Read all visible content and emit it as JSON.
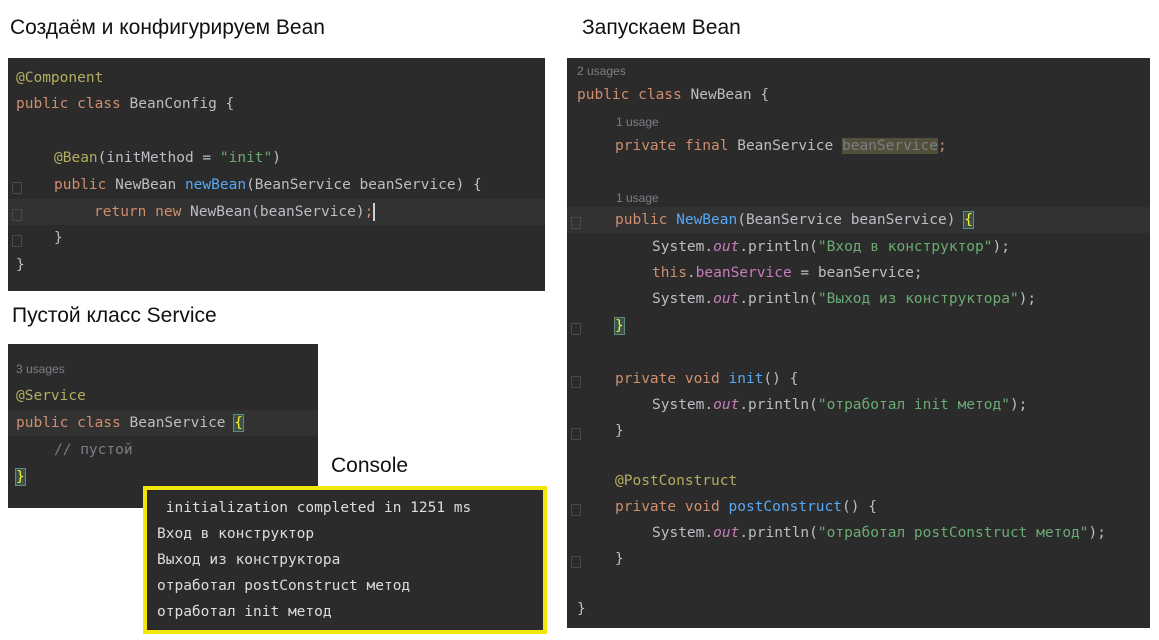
{
  "captions": {
    "config": "Создаём и конфигурируем Bean",
    "run": "Запускаем Bean",
    "service": "Пустой класс Service",
    "console": "Console"
  },
  "config_code": {
    "l1_ann": "@Component",
    "l2_kw": "public class ",
    "l2_name": "BeanConfig {",
    "l4_ann": "@Bean",
    "l4_rest": "(initMethod = ",
    "l4_str": "\"init\"",
    "l4_end": ")",
    "l5_kw": "public ",
    "l5_type": "NewBean ",
    "l5_fn": "newBean",
    "l5_rest": "(BeanService beanService) {",
    "l6_kw": "return new ",
    "l6_rest": "NewBean(beanService)",
    "l6_semi": ";",
    "l7": "}",
    "l8": "}"
  },
  "service_code": {
    "usages": "3 usages",
    "l1_ann": "@Service",
    "l2_kw": "public class ",
    "l2_name": "BeanService ",
    "l2_brace": "{",
    "l3_cmt": "// пустой",
    "l4": "}"
  },
  "newbean_code": {
    "usages_top": "2 usages",
    "l1_kw": "public class ",
    "l1_name": "NewBean {",
    "usage1": "1 usage",
    "l2_kw": "private final ",
    "l2_type": "BeanService ",
    "l2_field": "beanService",
    "l2_semi": ";",
    "usage2": "1 usage",
    "l3_kw": "public ",
    "l3_fn": "NewBean",
    "l3_rest": "(BeanService beanService) ",
    "l3_brace": "{",
    "l4_a": "System.",
    "l4_out": "out",
    "l4_b": ".println(",
    "l4_str": "\"Вход в конструктор\"",
    "l4_c": ");",
    "l5_kw": "this",
    "l5_dot": ".",
    "l5_field": "beanService",
    "l5_rest": " = beanService;",
    "l6_a": "System.",
    "l6_out": "out",
    "l6_b": ".println(",
    "l6_str": "\"Выход из конструктора\"",
    "l6_c": ");",
    "l7_brace": "}",
    "l8_kw": "private void ",
    "l8_fn": "init",
    "l8_rest": "() {",
    "l9_a": "System.",
    "l9_out": "out",
    "l9_b": ".println(",
    "l9_str": "\"отработал init метод\"",
    "l9_c": ");",
    "l10": "}",
    "l11_ann": "@PostConstruct",
    "l12_kw": "private void ",
    "l12_fn": "postConstruct",
    "l12_rest": "() {",
    "l13_a": "System.",
    "l13_out": "out",
    "l13_b": ".println(",
    "l13_str": "\"отработал postConstruct метод\"",
    "l13_c": ");",
    "l14": "}",
    "l15": "}"
  },
  "console_lines": [
    " initialization completed in 1251 ms",
    "Вход в конструктор",
    "Выход из конструктора",
    "отработал postConstruct метод",
    "отработал init метод"
  ],
  "colors": {
    "editor_bg": "#2b2b2b",
    "keyword": "#cf8e6d",
    "annotation": "#b3ae60",
    "string": "#6aab73",
    "method": "#56a8f5",
    "field": "#c77dbb",
    "console_border": "#f2e50b"
  }
}
